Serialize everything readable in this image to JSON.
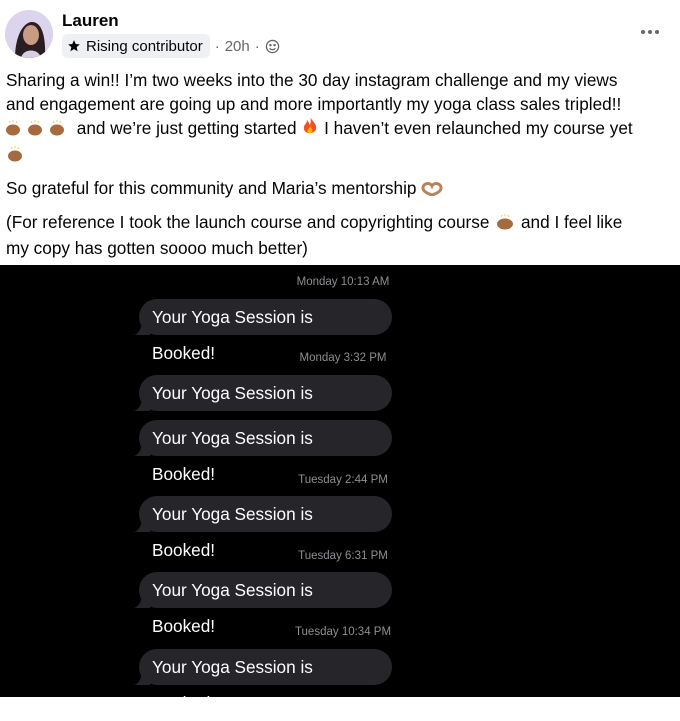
{
  "post": {
    "author": "Lauren",
    "badge": "Rising contributor",
    "separator": "·",
    "time": "20h",
    "line1": "Sharing a win!! I’m two weeks into the 30 day instagram challenge and my views",
    "line2": "and engagement are going up and more importantly my yoga class sales tripled!!",
    "line3": "and we’re just getting started",
    "line3b": "I haven’t even relaunched my course yet",
    "p2": "So grateful for this community and Maria’s mentorship",
    "p3a": "(For reference I took the launch course and copyrighting course",
    "p3b": "and I feel like",
    "p3c": "my copy has gotten soooo much better)"
  },
  "icons": {
    "star": "star-icon",
    "globe": "privacy-globe-icon",
    "more": "more-options-icon",
    "raised_hands": "raised-hands-emoji",
    "fire": "fire-emoji",
    "heart_hands": "heart-hands-emoji"
  },
  "messages": [
    {
      "timestamp": "Monday 10:13 AM",
      "texts": [
        "Your Yoga Session is Booked!"
      ]
    },
    {
      "timestamp": "Monday 3:32 PM",
      "texts": [
        "Your Yoga Session is Booked!",
        "Your Yoga Session is Booked!"
      ]
    },
    {
      "timestamp": "Tuesday 2:44 PM",
      "texts": [
        "Your Yoga Session is Booked!"
      ]
    },
    {
      "timestamp": "Tuesday 6:31 PM",
      "texts": [
        "Your Yoga Session is Booked!"
      ]
    },
    {
      "timestamp": "Tuesday 10:34 PM",
      "texts": [
        "Your Yoga Session is Booked!"
      ]
    }
  ],
  "colors": {
    "bubble": "#26252a",
    "timestamp": "#8e8e93",
    "muted_text": "#65676b"
  }
}
